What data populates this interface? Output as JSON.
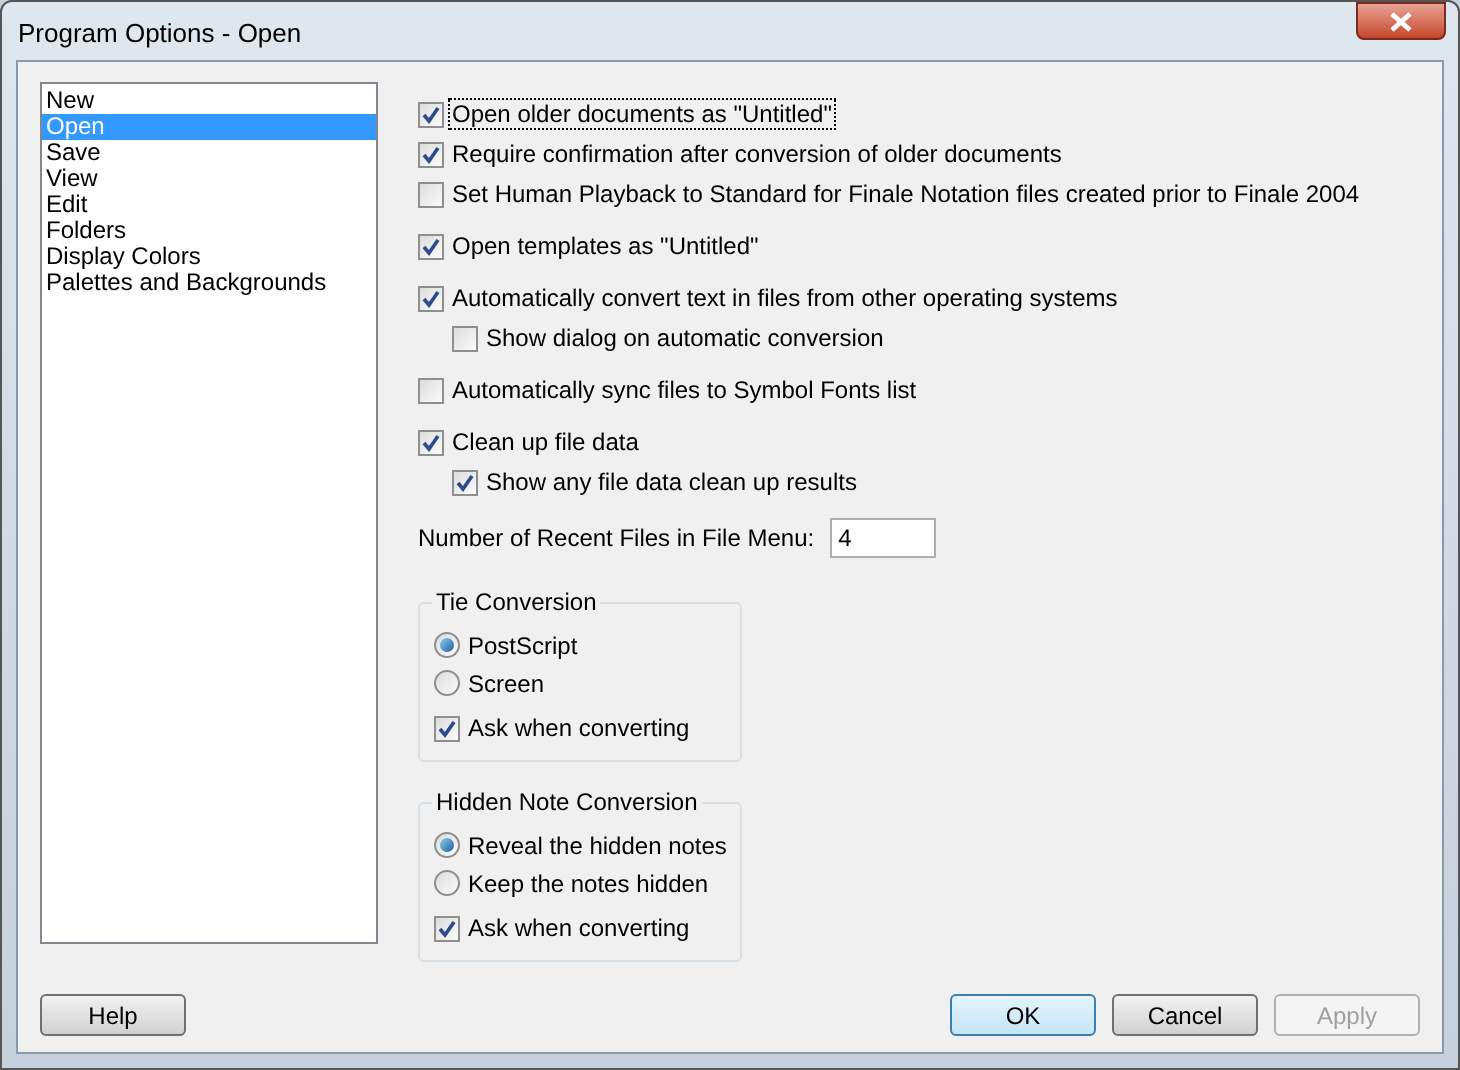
{
  "window": {
    "title": "Program Options - Open"
  },
  "sidebar": {
    "items": [
      {
        "label": "New",
        "selected": false
      },
      {
        "label": "Open",
        "selected": true
      },
      {
        "label": "Save",
        "selected": false
      },
      {
        "label": "View",
        "selected": false
      },
      {
        "label": "Edit",
        "selected": false
      },
      {
        "label": "Folders",
        "selected": false
      },
      {
        "label": "Display Colors",
        "selected": false
      },
      {
        "label": "Palettes and Backgrounds",
        "selected": false
      }
    ]
  },
  "option_groups": [
    [
      {
        "label": "Open older documents as \"Untitled\"",
        "checked": true,
        "focused": true
      },
      {
        "label": "Require confirmation after conversion of older documents",
        "checked": true,
        "focused": false
      },
      {
        "label": "Set Human Playback to Standard for Finale Notation files created prior to Finale 2004",
        "checked": false,
        "focused": false
      }
    ],
    [
      {
        "label": "Open templates as \"Untitled\"",
        "checked": true,
        "focused": false
      }
    ],
    [
      {
        "label": "Automatically convert text in files from other operating systems",
        "checked": true,
        "focused": false,
        "children": [
          {
            "label": "Show dialog on automatic conversion",
            "checked": false,
            "focused": false
          }
        ]
      }
    ],
    [
      {
        "label": "Automatically sync files to Symbol Fonts list",
        "checked": false,
        "focused": false
      }
    ],
    [
      {
        "label": "Clean up file data",
        "checked": true,
        "focused": false,
        "children": [
          {
            "label": "Show any file data clean up results",
            "checked": true,
            "focused": false
          }
        ]
      }
    ]
  ],
  "recent_files": {
    "label": "Number of Recent Files in File Menu:",
    "value": "4"
  },
  "groups": [
    {
      "title": "Tie Conversion",
      "items": [
        {
          "kind": "radio",
          "label": "PostScript",
          "selected": true
        },
        {
          "kind": "radio",
          "label": "Screen",
          "selected": false
        },
        {
          "kind": "checkbox",
          "label": "Ask when converting",
          "checked": true
        }
      ]
    },
    {
      "title": "Hidden Note Conversion",
      "items": [
        {
          "kind": "radio",
          "label": "Reveal the hidden notes",
          "selected": true
        },
        {
          "kind": "radio",
          "label": "Keep the notes hidden",
          "selected": false
        },
        {
          "kind": "checkbox",
          "label": "Ask when converting",
          "checked": true
        }
      ]
    }
  ],
  "buttons_left": [
    {
      "label": "Help",
      "default": false,
      "disabled": false
    }
  ],
  "buttons_right": [
    {
      "label": "OK",
      "default": true,
      "disabled": false
    },
    {
      "label": "Cancel",
      "default": false,
      "disabled": false
    },
    {
      "label": "Apply",
      "default": false,
      "disabled": true
    }
  ]
}
